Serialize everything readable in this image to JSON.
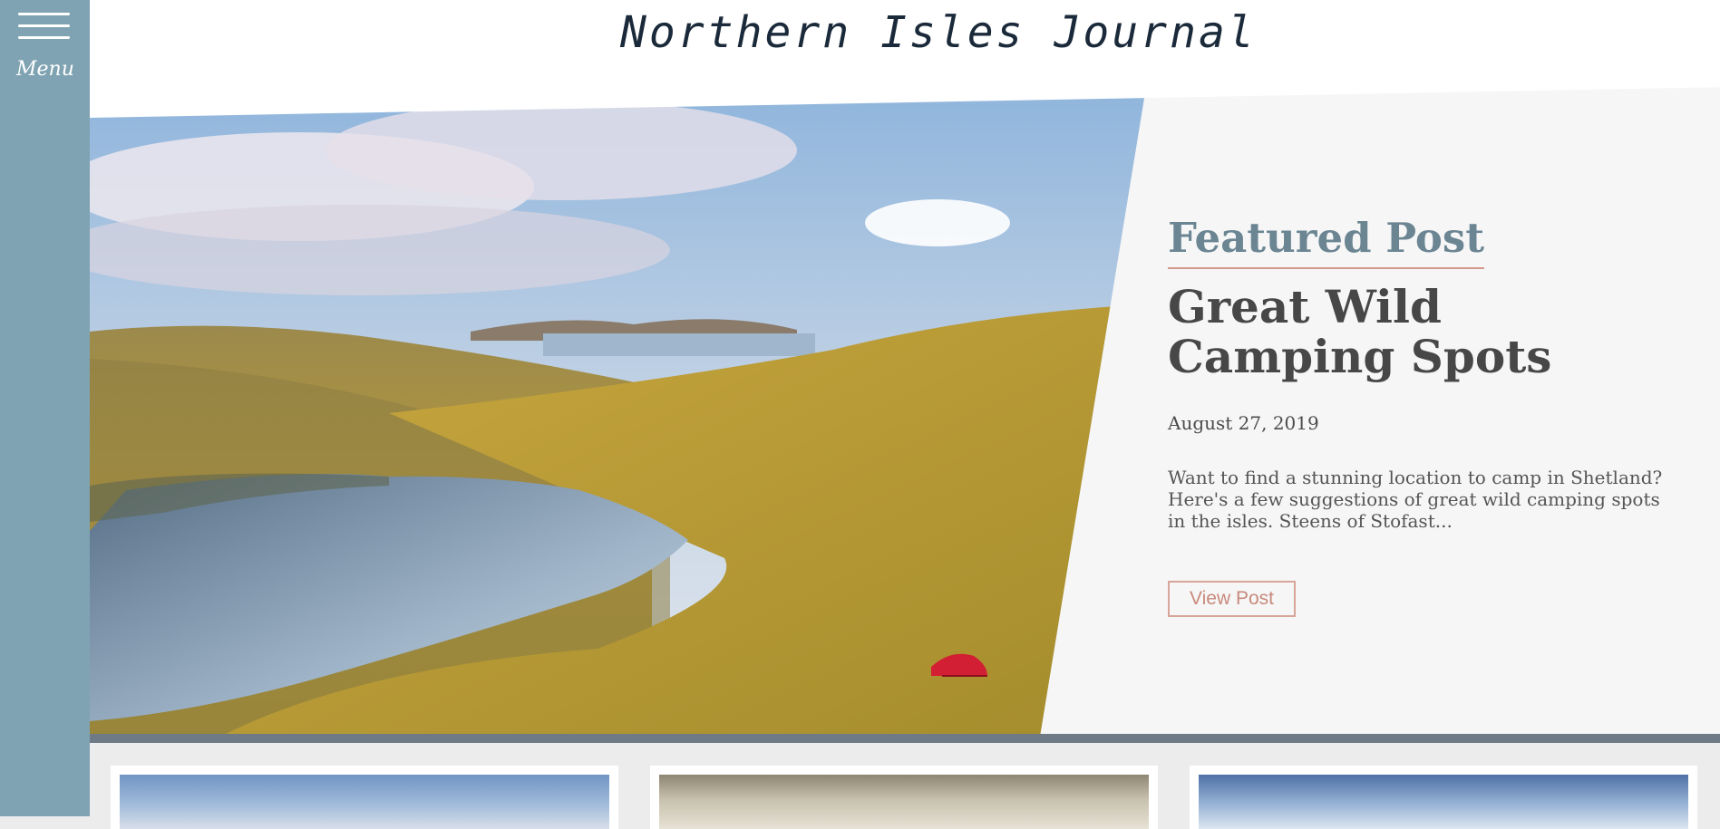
{
  "sidebar": {
    "menu_label": "Menu"
  },
  "header": {
    "site_title": "Northern Isles Journal"
  },
  "featured": {
    "section_label": "Featured Post",
    "title": "Great Wild Camping Spots",
    "date": "August 27, 2019",
    "excerpt": "Want to find a stunning location to camp in Shetland? Here's a few suggestions of great wild camping spots in the isles. Steens of Stofast...",
    "button_label": "View Post"
  },
  "colors": {
    "sidebar": "#7fa3b2",
    "featured_label": "#6b8593",
    "accent": "#d3998a",
    "title_text": "#474747",
    "divider": "#6e7b87"
  },
  "icons": {
    "menu": "hamburger-icon"
  }
}
